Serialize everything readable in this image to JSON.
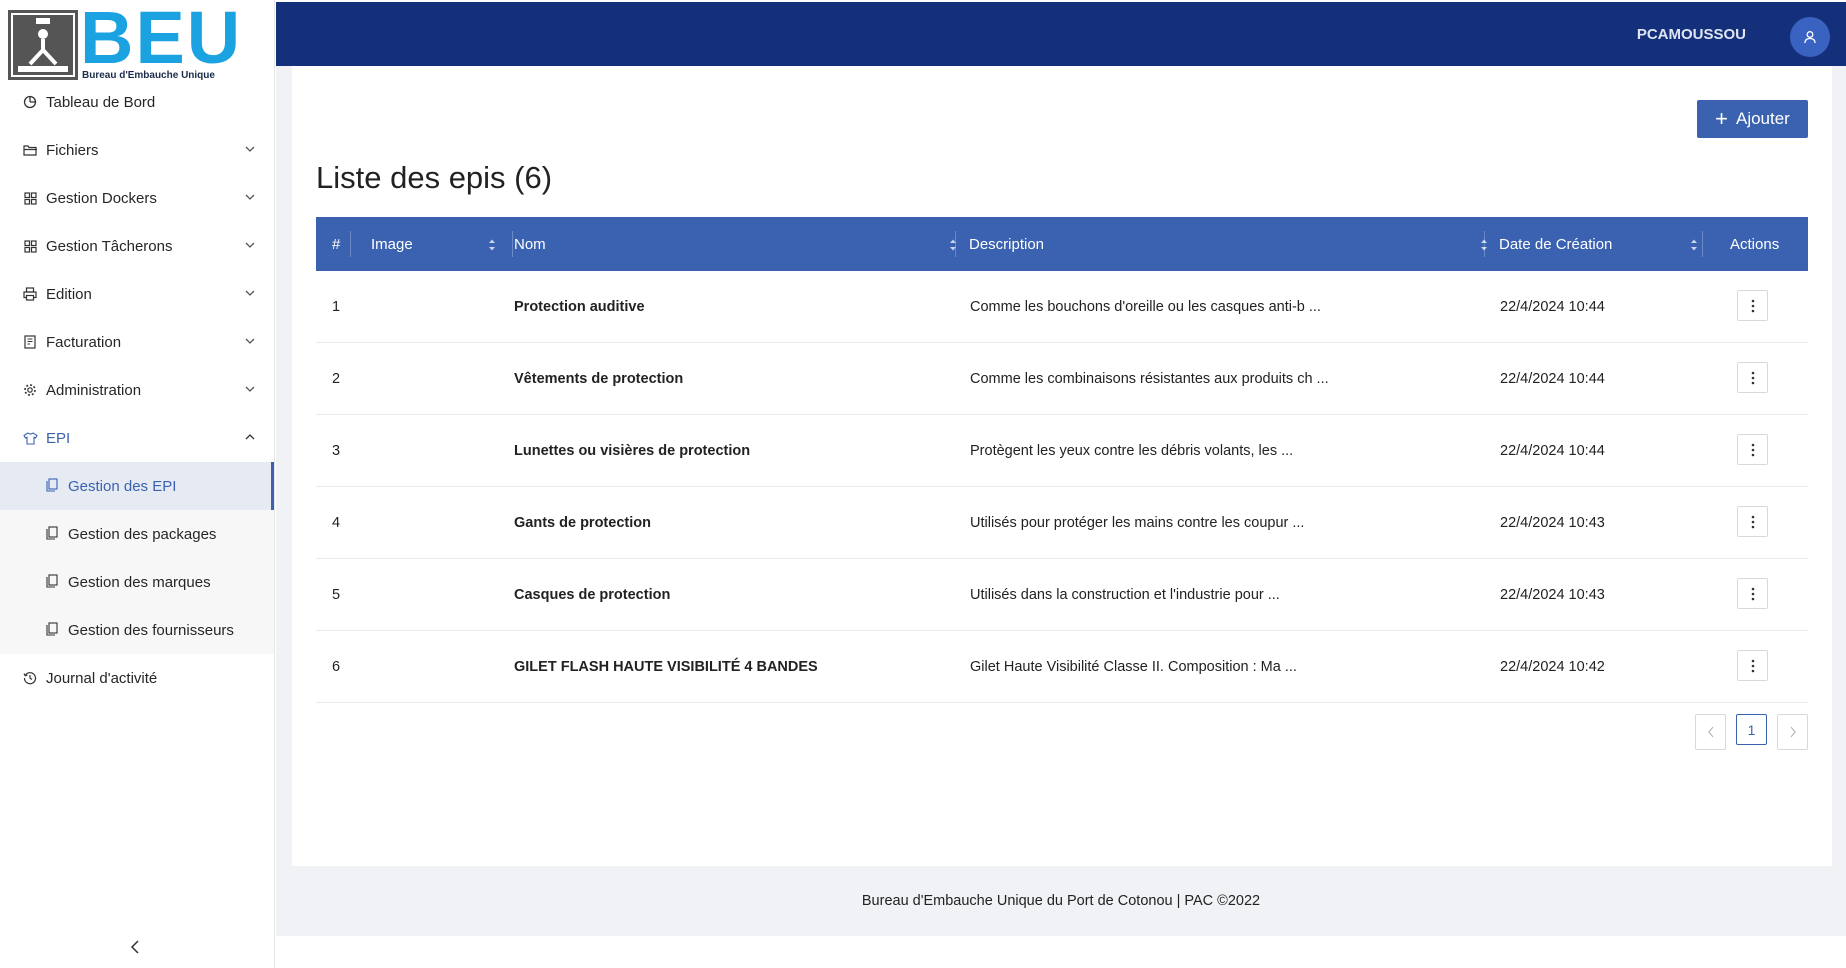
{
  "brand": {
    "logo_text": "BEU",
    "logo_subtitle": "Bureau d'Embauche Unique",
    "accent_color": "#1aa3e0"
  },
  "header": {
    "username": "PCAMOUSSOU",
    "bg_color": "#14307a"
  },
  "sidebar": {
    "items": [
      {
        "label": "Tableau de Bord",
        "icon": "dashboard-icon"
      },
      {
        "label": "Fichiers",
        "icon": "folder-icon"
      },
      {
        "label": "Gestion Dockers",
        "icon": "grid-icon"
      },
      {
        "label": "Gestion Tâcherons",
        "icon": "grid-icon"
      },
      {
        "label": "Edition",
        "icon": "printer-icon"
      },
      {
        "label": "Facturation",
        "icon": "invoice-icon"
      },
      {
        "label": "Administration",
        "icon": "gear-icon"
      },
      {
        "label": "EPI",
        "icon": "shirt-icon"
      },
      {
        "label": "Journal d'activité",
        "icon": "history-icon"
      }
    ],
    "epi_submenu": [
      {
        "label": "Gestion des EPI",
        "active": true
      },
      {
        "label": "Gestion des packages",
        "active": false
      },
      {
        "label": "Gestion des marques",
        "active": false
      },
      {
        "label": "Gestion des fournisseurs",
        "active": false
      }
    ]
  },
  "main": {
    "add_button": "Ajouter",
    "title": "Liste des epis (6)",
    "columns": [
      "#",
      "Image",
      "Nom",
      "Description",
      "Date de Création",
      "Actions"
    ],
    "rows": [
      {
        "num": "1",
        "name": "Protection auditive",
        "description": "Comme les bouchons d'oreille ou les casques anti-b ...",
        "date": "22/4/2024 10:44"
      },
      {
        "num": "2",
        "name": "Vêtements de protection",
        "description": "Comme les combinaisons résistantes aux produits ch ...",
        "date": "22/4/2024 10:44"
      },
      {
        "num": "3",
        "name": "Lunettes ou visières de protection",
        "description": "Protègent les yeux contre les débris volants, les ...",
        "date": "22/4/2024 10:44"
      },
      {
        "num": "4",
        "name": "Gants de protection",
        "description": "Utilisés pour protéger les mains contre les coupur ...",
        "date": "22/4/2024 10:43"
      },
      {
        "num": "5",
        "name": "Casques de protection",
        "description": "Utilisés dans la construction et l'industrie pour ...",
        "date": "22/4/2024 10:43"
      },
      {
        "num": "6",
        "name": "GILET FLASH HAUTE VISIBILITÉ 4 BANDES",
        "description": "Gilet Haute Visibilité Classe II. Composition : Ma ...",
        "date": "22/4/2024 10:42"
      }
    ],
    "pagination": {
      "current_page": "1"
    },
    "primary_color": "#3a62b0"
  },
  "footer": {
    "text": "Bureau d'Embauche Unique du Port de Cotonou | PAC ©2022"
  }
}
